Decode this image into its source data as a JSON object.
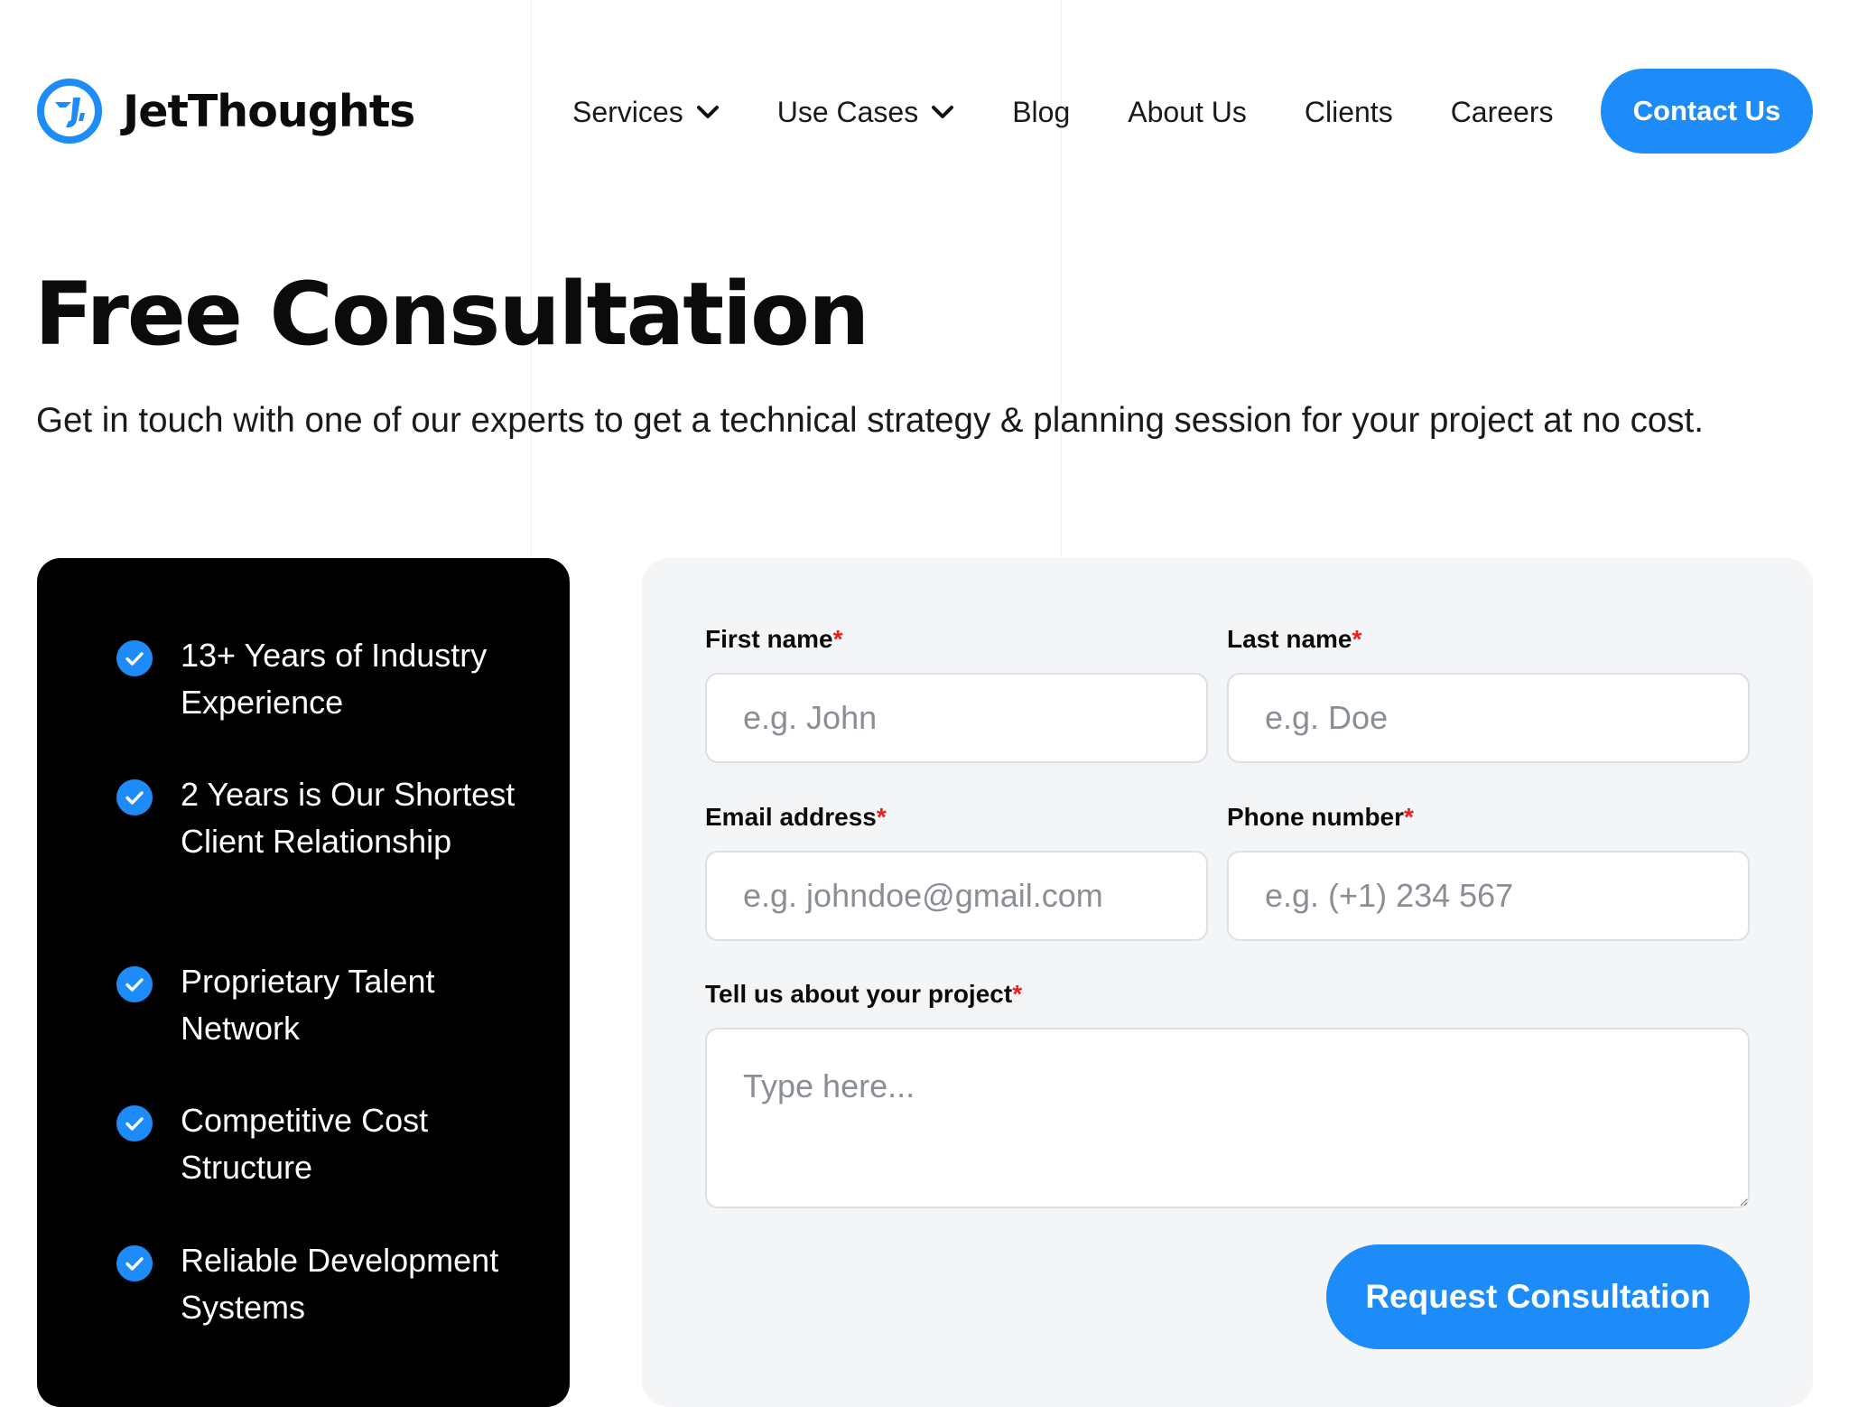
{
  "brand": {
    "name": "JetThoughts",
    "logo_icon": "jetthoughts-logo-icon",
    "accent_color": "#1d8cf8"
  },
  "nav": {
    "items": [
      {
        "label": "Services",
        "dropdown": true
      },
      {
        "label": "Use Cases",
        "dropdown": true
      },
      {
        "label": "Blog",
        "dropdown": false
      },
      {
        "label": "About Us",
        "dropdown": false
      },
      {
        "label": "Clients",
        "dropdown": false
      },
      {
        "label": "Careers",
        "dropdown": false
      }
    ],
    "cta_label": "Contact Us"
  },
  "hero": {
    "title": "Free Consultation",
    "subtitle": "Get in touch with one of our experts to get a technical strategy & planning session for your project at no cost."
  },
  "benefits": {
    "icon": "check-circle-icon",
    "items": [
      "13+ Years of Industry Experience",
      "2 Years is Our Shortest Client Relationship",
      "Proprietary Talent Network",
      "Competitive Cost Structure",
      "Reliable Development Systems"
    ]
  },
  "form": {
    "required_marker": "*",
    "first_name": {
      "label": "First name",
      "placeholder": "e.g. John",
      "value": ""
    },
    "last_name": {
      "label": "Last name",
      "placeholder": "e.g. Doe",
      "value": ""
    },
    "email": {
      "label": "Email address",
      "placeholder": "e.g. johndoe@gmail.com",
      "value": ""
    },
    "phone": {
      "label": "Phone number",
      "placeholder": "e.g. (+1) 234 567",
      "value": ""
    },
    "project": {
      "label": "Tell us about your project",
      "placeholder": "Type here...",
      "value": ""
    },
    "submit_label": "Request Consultation"
  }
}
